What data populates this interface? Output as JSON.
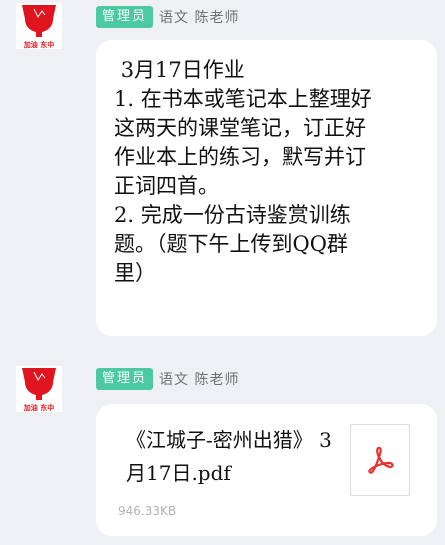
{
  "messages": [
    {
      "badge": "管理员",
      "sender": "语文 陈老师",
      "text": " 3月17日作业\n1. 在书本或笔记本上整理好\n这两天的课堂笔记，订正好\n作业本上的练习，默写并订\n正词四首。\n2. 完成一份古诗鉴赏训练\n题。（题下午上传到QQ群\n里）"
    },
    {
      "badge": "管理员",
      "sender": "语文 陈老师",
      "file": {
        "name": "《江城子-密州出猎》 3月17日.pdf",
        "size": "946.33KB",
        "icon": "pdf-file-icon"
      }
    }
  ],
  "colors": {
    "badge": "#4cc9a1",
    "pdf_red": "#e8322d",
    "avatar_red": "#e0141e",
    "background": "#eef0f3"
  }
}
